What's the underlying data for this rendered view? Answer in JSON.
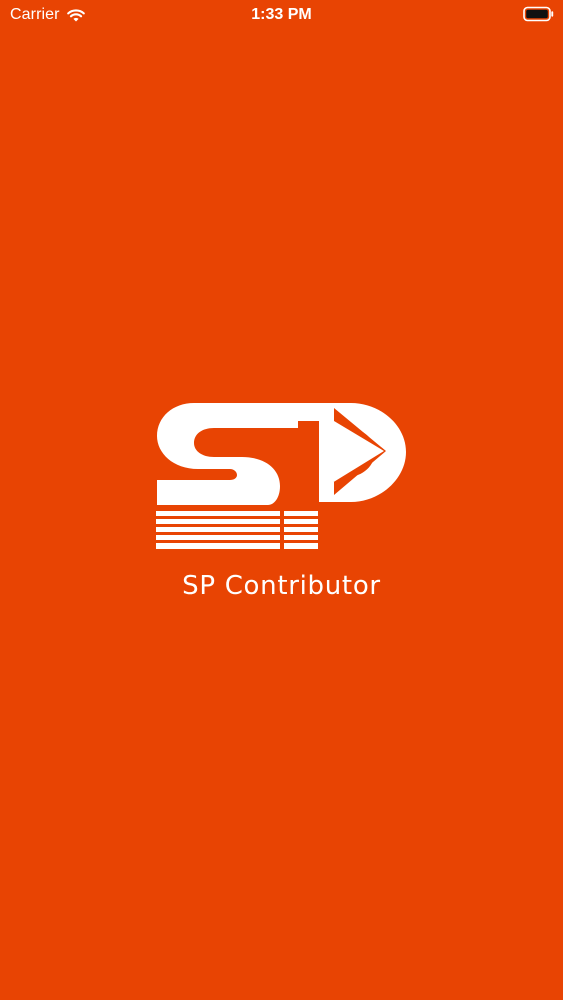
{
  "status_bar": {
    "carrier": "Carrier",
    "time": "1:33 PM",
    "wifi_icon": "wifi-icon",
    "battery_icon": "battery-icon"
  },
  "splash": {
    "logo_icon": "sp-logo-icon",
    "app_name": "SP Contributor"
  },
  "colors": {
    "background": "#E84403",
    "foreground": "#FFFFFF"
  }
}
